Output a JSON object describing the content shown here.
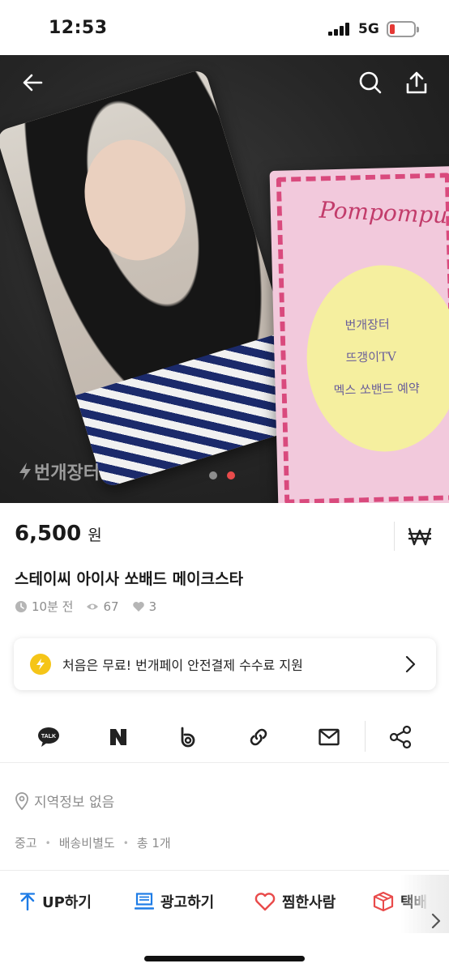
{
  "status_bar": {
    "time": "12:53",
    "network": "5G",
    "battery_color": "#e53935"
  },
  "photo": {
    "watermark": "번개장터",
    "note_script": "Pompompurin",
    "note_lines": [
      "번개장터",
      "뜨갱이TV",
      "멕스 쏘밴드 예약"
    ],
    "pages": 2,
    "active_page": 2,
    "icons": {
      "back": "back-arrow-icon",
      "search": "search-icon",
      "share": "share-upload-icon"
    }
  },
  "product": {
    "price": "6,500",
    "currency": "원",
    "title": "스테이씨 아이사 쏘배드 메이크스타",
    "time_ago": "10분 전",
    "views": "67",
    "likes": "3"
  },
  "banner": {
    "text": "처음은 무료! 번개페이 안전결제 수수료 지원"
  },
  "share": {
    "items": [
      "kakaotalk-icon",
      "naver-icon",
      "band-icon",
      "link-icon",
      "mail-icon",
      "share-icon"
    ]
  },
  "info": {
    "location": "지역정보 없음",
    "condition": "중고",
    "shipping": "배송비별도",
    "quantity": "총 1개"
  },
  "actions": {
    "up": "UP하기",
    "ad": "광고하기",
    "likers": "찜한사람",
    "delivery": "택배"
  },
  "colors": {
    "accent_red": "#e94b4b",
    "accent_blue": "#1e7ce6",
    "bolt_yellow": "#f5c518"
  }
}
